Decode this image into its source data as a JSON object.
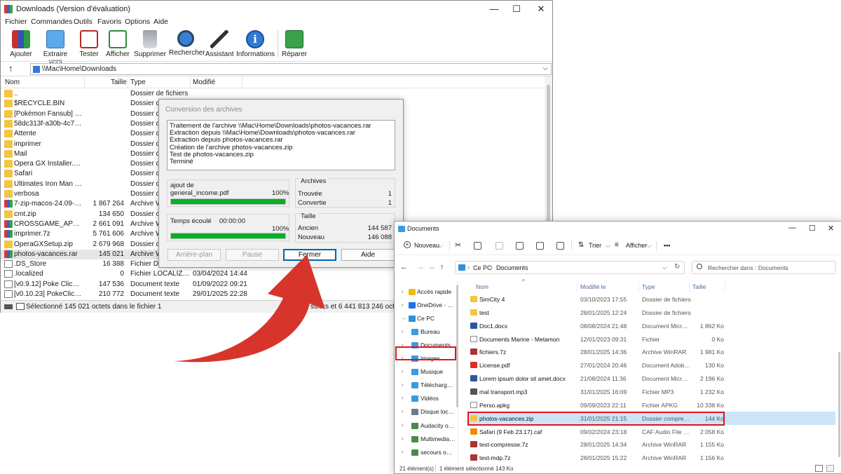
{
  "winrar": {
    "title": "Downloads (Version d'évaluation)",
    "window_controls": {
      "min": "—",
      "max": "☐",
      "close": "✕"
    },
    "menu": [
      "Fichier",
      "Commandes",
      "Outils",
      "Favoris",
      "Options",
      "Aide"
    ],
    "toolbar": [
      {
        "label": "Ajouter",
        "icon": "archive-add-icon"
      },
      {
        "label": "Extraire vers",
        "icon": "extract-folder-icon"
      },
      {
        "label": "Tester",
        "icon": "test-clipboard-icon"
      },
      {
        "label": "Afficher",
        "icon": "view-book-icon"
      },
      {
        "label": "Supprimer",
        "icon": "trash-icon"
      },
      {
        "label": "Rechercher",
        "icon": "magnifier-icon"
      },
      {
        "label": "Assistant",
        "icon": "wizard-wand-icon"
      },
      {
        "label": "Informations",
        "icon": "info-icon"
      },
      {
        "label": "Réparer",
        "icon": "repair-book-icon"
      }
    ],
    "up_arrow": "↑",
    "path": "\\\\Mac\\Home\\Downloads",
    "columns": [
      "Nom",
      "Taille",
      "Type",
      "Modifié"
    ],
    "files": [
      {
        "name": "..",
        "size": "",
        "type": "Dossier de fichiers",
        "date": "",
        "icon": "folder"
      },
      {
        "name": "$RECYCLE.BIN",
        "size": "",
        "type": "Dossier de",
        "date": "",
        "icon": "folder"
      },
      {
        "name": "[Pokémon Fansub] Pok...",
        "size": "",
        "type": "Dossier de",
        "date": "",
        "icon": "folder"
      },
      {
        "name": "58dc313f-a30b-4c75-95...",
        "size": "",
        "type": "Dossier de",
        "date": "",
        "icon": "folder"
      },
      {
        "name": "Attente",
        "size": "",
        "type": "Dossier de",
        "date": "",
        "icon": "folder"
      },
      {
        "name": "imprimer",
        "size": "",
        "type": "Dossier de",
        "date": "",
        "icon": "folder"
      },
      {
        "name": "Mail",
        "size": "",
        "type": "Dossier de",
        "date": "",
        "icon": "folder"
      },
      {
        "name": "Opera GX Installer.app",
        "size": "",
        "type": "Dossier de",
        "date": "",
        "icon": "folder"
      },
      {
        "name": "Safari",
        "size": "",
        "type": "Dossier de",
        "date": "",
        "icon": "folder"
      },
      {
        "name": "Ultimates Iron Man II --...",
        "size": "",
        "type": "Dossier de",
        "date": "",
        "icon": "folder"
      },
      {
        "name": "verbosa",
        "size": "",
        "type": "Dossier de",
        "date": "",
        "icon": "folder"
      },
      {
        "name": "7-zip-macos-24.09-329...",
        "size": "1 867 264",
        "type": "Archive W",
        "date": "",
        "icon": "rar"
      },
      {
        "name": "cmt.zip",
        "size": "134 650",
        "type": "Dossier co",
        "date": "",
        "icon": "folder"
      },
      {
        "name": "CROSSGAME_APP.rar",
        "size": "2 661 091",
        "type": "Archive W",
        "date": "",
        "icon": "rar"
      },
      {
        "name": "imprimer.7z",
        "size": "5 761 606",
        "type": "Archive W",
        "date": "",
        "icon": "rar"
      },
      {
        "name": "OperaGXSetup.zip",
        "size": "2 679 968",
        "type": "Dossier co",
        "date": "",
        "icon": "folder"
      },
      {
        "name": "photos-vacances.rar",
        "size": "145 021",
        "type": "Archive W",
        "date": "",
        "icon": "rar",
        "selected": true
      },
      {
        "name": ".DS_Store",
        "size": "16 388",
        "type": "Fichier DS_",
        "date": "",
        "icon": "file"
      },
      {
        "name": ".localized",
        "size": "0",
        "type": "Fichier LOCALIZED",
        "date": "03/04/2024 14:44",
        "icon": "file"
      },
      {
        "name": "[v0.9.12] Poke Clicker B...",
        "size": "147 536",
        "type": "Document texte",
        "date": "01/09/2022 09:21",
        "icon": "file"
      },
      {
        "name": "[v0.10.23] PokeClicker-...",
        "size": "210 772",
        "type": "Document texte",
        "date": "29/01/2025 22:28",
        "icon": "file"
      }
    ],
    "status_left": "Sélectionné 145 021 octets dans le fichier 1",
    "status_right": "Total ssiers et 6 441 813 246 octets"
  },
  "conversion": {
    "title": "Conversion des archives",
    "log": [
      "Traitement de l'archive \\\\Mac\\Home\\Downloads\\photos-vacances.rar",
      "Extraction depuis \\\\Mac\\Home\\Downloads\\photos-vacances.rar",
      "Extraction depuis photos-vacances.rar",
      "Création de l'archive photos-vacances.zip",
      "Test de photos-vacances.zip",
      "Terminé"
    ],
    "current_label": "ajout de",
    "current_file": "general_income.pdf",
    "current_percent": "100%",
    "current_progress": 1.0,
    "elapsed_label": "Temps écoulé",
    "elapsed_value": "00:00:00",
    "total_percent": "100%",
    "total_progress": 1.0,
    "archives_header": "Archives",
    "found_label": "Trouvée",
    "found_value": "1",
    "converted_label": "Convertie",
    "converted_value": "1",
    "size_header": "Taille",
    "old_label": "Ancien",
    "old_value": "144 587",
    "new_label": "Nouveau",
    "new_value": "146 088",
    "buttons": {
      "background": "Arrière-plan",
      "pause": "Pause",
      "close": "Fermer",
      "help": "Aide"
    }
  },
  "explorer": {
    "title": "Documents",
    "window_controls": {
      "min": "—",
      "max": "☐",
      "close": "✕"
    },
    "new_label": "Nouveau",
    "sort_label": "Trier",
    "view_label": "Afficher",
    "more_label": "•••",
    "breadcrumb": [
      "Ce PC",
      "Documents"
    ],
    "search_placeholder": "Rechercher dans : Documents",
    "nav": [
      {
        "label": "Accès rapide",
        "icon": "star-icon",
        "color": "#f2b90d",
        "indent": 0
      },
      {
        "label": "OneDrive - Perso",
        "icon": "cloud-icon",
        "color": "#1a73e8",
        "indent": 0
      },
      {
        "label": "Ce PC",
        "icon": "pc-icon",
        "color": "#2f8fd8",
        "indent": 0,
        "expanded": true
      },
      {
        "label": "Bureau",
        "icon": "desktop-folder-icon",
        "color": "#3b9be0",
        "indent": 1
      },
      {
        "label": "Documents",
        "icon": "documents-folder-icon",
        "color": "#3b9be0",
        "indent": 1,
        "highlight": true
      },
      {
        "label": "Images",
        "icon": "images-folder-icon",
        "color": "#3b9be0",
        "indent": 1
      },
      {
        "label": "Musique",
        "icon": "music-folder-icon",
        "color": "#3b9be0",
        "indent": 1
      },
      {
        "label": "Téléchargemen",
        "icon": "downloads-folder-icon",
        "color": "#3b9be0",
        "indent": 1
      },
      {
        "label": "Vidéos",
        "icon": "videos-folder-icon",
        "color": "#3b9be0",
        "indent": 1
      },
      {
        "label": "Disque local (C",
        "icon": "drive-icon",
        "color": "#6b7b8c",
        "indent": 1
      },
      {
        "label": "Audacity on 'M",
        "icon": "network-drive-icon",
        "color": "#4a8a4a",
        "indent": 1
      },
      {
        "label": "Multimedia on",
        "icon": "network-drive-icon",
        "color": "#4a8a4a",
        "indent": 1
      },
      {
        "label": "secours on 'Ma",
        "icon": "network-drive-icon",
        "color": "#4a8a4a",
        "indent": 1
      }
    ],
    "columns": [
      "Nom",
      "Modifié le",
      "Type",
      "Taille"
    ],
    "files": [
      {
        "name": "SimCity 4",
        "date": "03/10/2023 17:55",
        "type": "Dossier de fichiers",
        "size": "",
        "icon": "folder",
        "color": "#f4c542"
      },
      {
        "name": "test",
        "date": "28/01/2025 12:24",
        "type": "Dossier de fichiers",
        "size": "",
        "icon": "folder",
        "color": "#f4c542"
      },
      {
        "name": "Doc1.docx",
        "date": "08/08/2024 21:48",
        "type": "Document Micros...",
        "size": "1 862 Ko",
        "icon": "word-doc",
        "color": "#2b579a"
      },
      {
        "name": "Documents Marine - Metamon",
        "date": "12/01/2023 09:31",
        "type": "Fichier",
        "size": "0 Ko",
        "icon": "file",
        "color": "#ffffff"
      },
      {
        "name": "fichiers.7z",
        "date": "28/01/2025 14:36",
        "type": "Archive WinRAR",
        "size": "1 981 Ko",
        "icon": "rar",
        "color": "#a33"
      },
      {
        "name": "License.pdf",
        "date": "27/01/2024 20:46",
        "type": "Document Adobe ...",
        "size": "130 Ko",
        "icon": "pdf",
        "color": "#d9302a"
      },
      {
        "name": "Lorem ipsum dolor sit amet.docx",
        "date": "21/08/2024 11:36",
        "type": "Document Micros...",
        "size": "2 196 Ko",
        "icon": "word-doc",
        "color": "#2b579a"
      },
      {
        "name": "mal transport.mp3",
        "date": "31/01/2025 16:09",
        "type": "Fichier MP3",
        "size": "1 232 Ko",
        "icon": "audio",
        "color": "#555"
      },
      {
        "name": "Perso.apkg",
        "date": "09/09/2023 22:11",
        "type": "Fichier APKG",
        "size": "10 338 Ko",
        "icon": "file",
        "color": "#ffffff"
      },
      {
        "name": "photos-vacances.zip",
        "date": "31/01/2025 21:15",
        "type": "Dossier compressé",
        "size": "144 Ko",
        "icon": "zip-folder",
        "color": "#f4c542",
        "selected": true
      },
      {
        "name": "Safari (9 Feb 23.17).caf",
        "date": "09/02/2024 23:18",
        "type": "CAF Audio File (V...",
        "size": "2 058 Ko",
        "icon": "vlc-cone",
        "color": "#f08a00"
      },
      {
        "name": "test-compresse.7z",
        "date": "28/01/2025 14:34",
        "type": "Archive WinRAR",
        "size": "1 155 Ko",
        "icon": "rar",
        "color": "#a33"
      },
      {
        "name": "test-mdp.7z",
        "date": "28/01/2025 15:22",
        "type": "Archive WinRAR",
        "size": "1 156 Ko",
        "icon": "rar",
        "color": "#a33"
      }
    ],
    "status_count": "21 élément(s)",
    "status_selected": "1 élément sélectionné  143 Ko"
  },
  "colors": {
    "accent_red": "#e0141e",
    "arrow_red": "#d7352b",
    "progress_green": "#06b025",
    "selection_blue": "#cce4f7"
  }
}
